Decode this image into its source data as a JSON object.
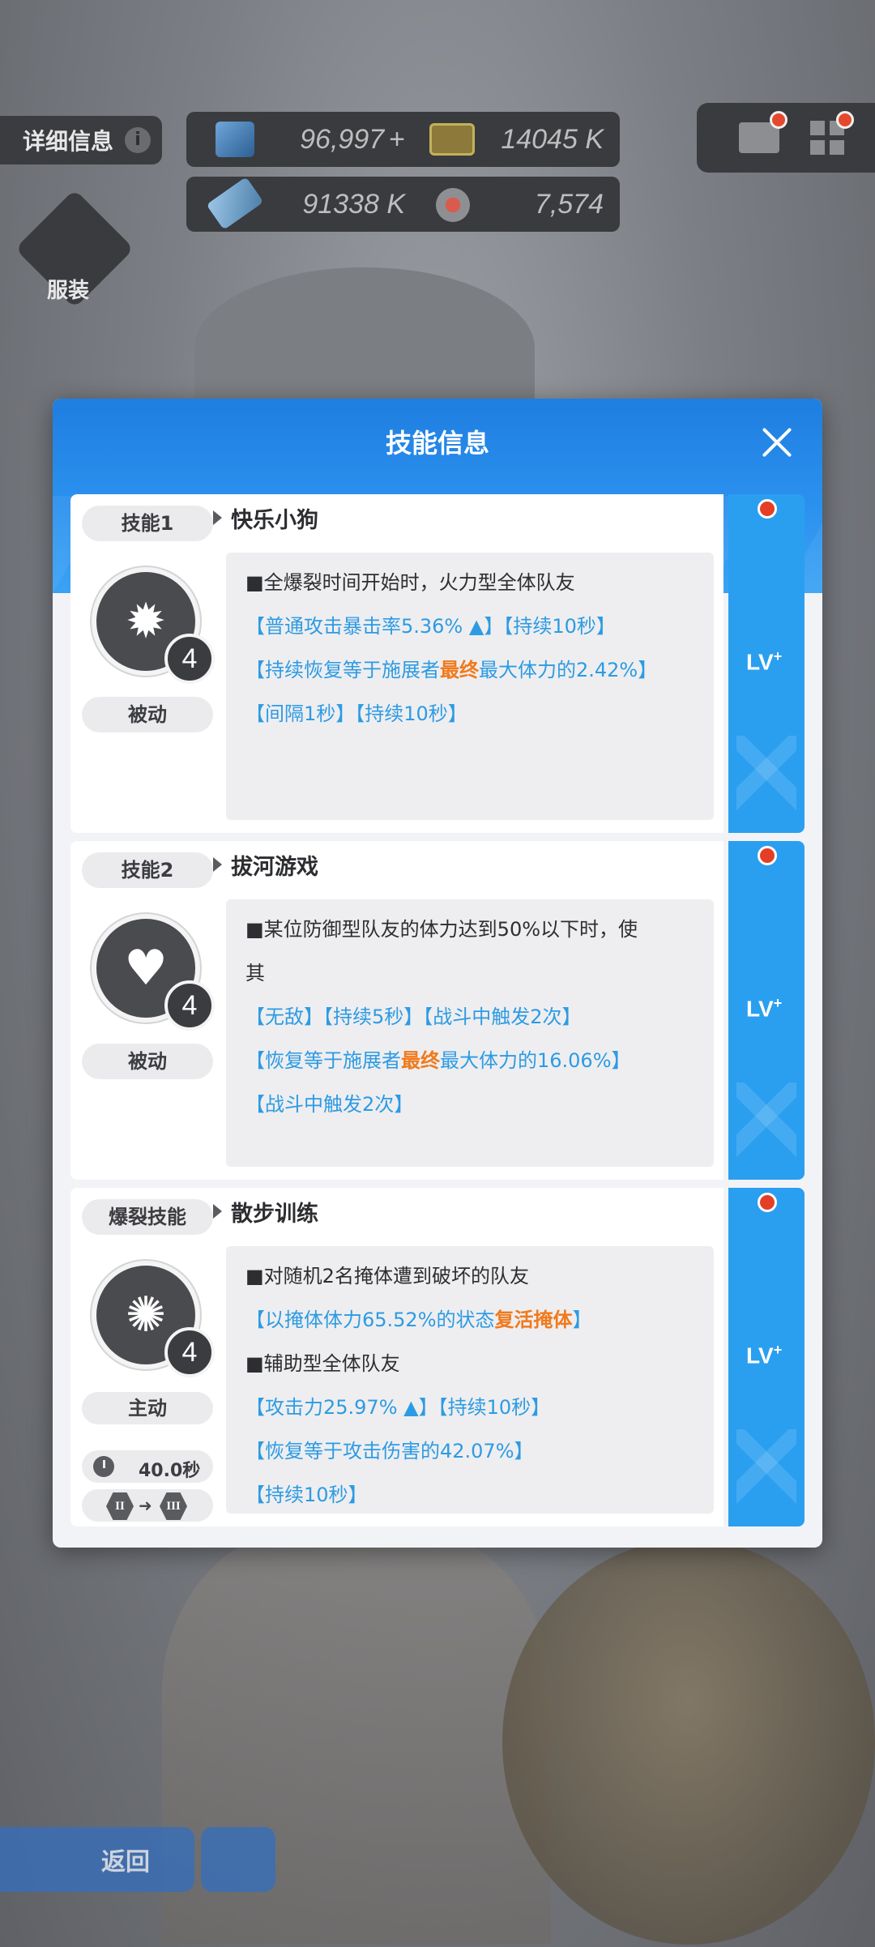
{
  "hud": {
    "detail_tab": "详细信息",
    "info_icon": "i",
    "resources": [
      {
        "value": "96,997",
        "plus": "+",
        "icon": "crystal-icon"
      },
      {
        "value": "14045 K",
        "icon": "battery-icon"
      },
      {
        "value": "91338 K",
        "icon": "syringe-icon"
      },
      {
        "value": "7,574",
        "icon": "core-icon"
      }
    ],
    "outfit_label": "服装",
    "back_label": "返回"
  },
  "modal": {
    "title": "技能信息",
    "lv_label": "LV",
    "lv_plus": "+",
    "skills": [
      {
        "tag": "技能1",
        "name": "快乐小狗",
        "type": "被动",
        "level": "4",
        "icon": "burst-percent-icon",
        "lines": [
          {
            "segments": [
              {
                "t": "■全爆裂时间开始时，火力型全体队友",
                "c": "n"
              }
            ]
          },
          {
            "segments": [
              {
                "t": "【普通攻击暴击率5.36% ▲】【持续10秒】",
                "c": "b"
              }
            ]
          },
          {
            "segments": [
              {
                "t": "【持续恢复等于施展者",
                "c": "b"
              },
              {
                "t": "最终",
                "c": "o"
              },
              {
                "t": "最大体力的2.42%】",
                "c": "b"
              }
            ]
          },
          {
            "segments": [
              {
                "t": "【间隔1秒】【持续10秒】",
                "c": "b"
              }
            ]
          }
        ]
      },
      {
        "tag": "技能2",
        "name": "拔河游戏",
        "type": "被动",
        "level": "4",
        "icon": "hearts-plus-icon",
        "lines": [
          {
            "segments": [
              {
                "t": "■某位防御型队友的体力达到50%以下时，使",
                "c": "n"
              }
            ]
          },
          {
            "segments": [
              {
                "t": "其",
                "c": "n"
              }
            ]
          },
          {
            "segments": [
              {
                "t": "【无敌】【持续5秒】【战斗中触发2次】",
                "c": "b"
              }
            ]
          },
          {
            "segments": [
              {
                "t": "【恢复等于施展者",
                "c": "b"
              },
              {
                "t": "最终",
                "c": "o"
              },
              {
                "t": "最大体力的16.06%】",
                "c": "b"
              }
            ]
          },
          {
            "segments": [
              {
                "t": "【战斗中触发2次】",
                "c": "b"
              }
            ]
          }
        ]
      },
      {
        "tag": "爆裂技能",
        "name": "散步训练",
        "type": "主动",
        "level": "4",
        "icon": "paw-badge-icon",
        "cooldown": "40.0秒",
        "phase_from": "II",
        "phase_to": "III",
        "lines": [
          {
            "segments": [
              {
                "t": "■对随机2名掩体遭到破坏的队友",
                "c": "n"
              }
            ]
          },
          {
            "segments": [
              {
                "t": "【以掩体体力65.52%的状态",
                "c": "b"
              },
              {
                "t": "复活掩体",
                "c": "o"
              },
              {
                "t": "】",
                "c": "b"
              }
            ]
          },
          {
            "segments": [
              {
                "t": "■辅助型全体队友",
                "c": "n"
              }
            ]
          },
          {
            "segments": [
              {
                "t": "【攻击力25.97% ▲】【持续10秒】",
                "c": "b"
              }
            ]
          },
          {
            "segments": [
              {
                "t": "【恢复等于攻击伤害的42.07%】",
                "c": "b"
              }
            ]
          },
          {
            "segments": [
              {
                "t": "【持续10秒】",
                "c": "b"
              }
            ]
          }
        ]
      }
    ]
  },
  "colors": {
    "accent_blue": "#2a9ff0",
    "text_blue": "#2d9be3",
    "text_orange": "#f07a1c",
    "badge_red": "#e43f26"
  }
}
